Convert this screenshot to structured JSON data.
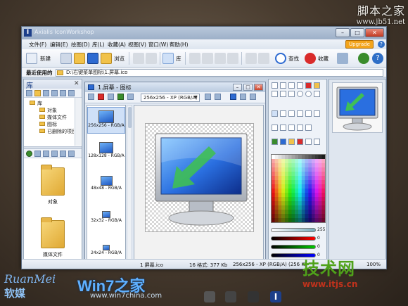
{
  "watermark_top": {
    "line1": "脚本之家",
    "line2": "www.jb51.net"
  },
  "window": {
    "app_title": "Axialis IconWorkshop",
    "controls": {
      "minimize": "–",
      "maximize": "□",
      "close": "✕"
    }
  },
  "menu": {
    "items": [
      "文件(F)",
      "编辑(E)",
      "绘图(D)",
      "库(L)",
      "收藏(A)",
      "视图(V)",
      "窗口(W)",
      "帮助(H)"
    ],
    "upgrade": "Upgrade",
    "help": "?"
  },
  "toolbar": {
    "new_label": "新建",
    "browse_label": "浏览",
    "library_label": "库",
    "search_label": "查找",
    "favorites_label": "收藏"
  },
  "address": {
    "label": "最近使用的",
    "path": "D:\\右键菜单图标\\1.屏幕.ico"
  },
  "library": {
    "title": "库",
    "close": "✕",
    "tree": [
      "库",
      "对象",
      "媒体文件",
      "图标",
      "已删除的项目"
    ],
    "folders": [
      "对象",
      "媒体文件"
    ]
  },
  "document": {
    "title": "1.屏幕 - 图标",
    "format_value": "256x256 - XP (RGB/A)",
    "thumbs": [
      {
        "label": "256x256 - RGB/A"
      },
      {
        "label": "128x128 - RGB/A"
      },
      {
        "label": "48x48 - RGB/A"
      },
      {
        "label": "32x32 - RGB/A"
      },
      {
        "label": "24x24 - RGB/A"
      }
    ]
  },
  "tools": {
    "sliders": [
      {
        "name": "Opacity",
        "value": "255"
      },
      {
        "name": "Red",
        "value": "0"
      },
      {
        "name": "Green",
        "value": "0"
      },
      {
        "name": "Blue",
        "value": "0"
      }
    ]
  },
  "status": {
    "file": "1 屏幕.ico",
    "formats": "16 格式: 377 Kb",
    "current": "256x256 - XP (RGB/A) (256 Kb",
    "zoom": "100%"
  },
  "brand": {
    "ruanmei": "RuanMei",
    "ruanmei_cn": "软媒",
    "win7": "Win7之家",
    "win7_url": "www.win7china.com",
    "itjs_cn": "技术网",
    "itjs_url": "www.itjs.cn"
  },
  "colors": {
    "accent_blue": "#2d6ad1",
    "upgrade_orange": "#f3a41b",
    "brand_green": "#4fa21a"
  }
}
